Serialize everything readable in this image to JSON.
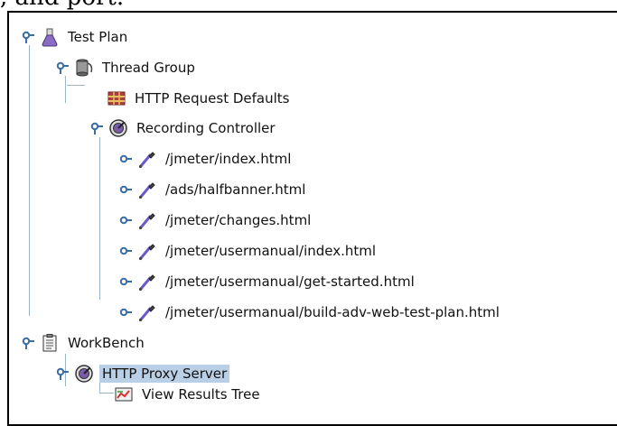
{
  "caption": ", and port.",
  "tree": {
    "test_plan": "Test Plan",
    "thread_group": "Thread Group",
    "http_request_defaults": "HTTP Request Defaults",
    "recording_controller": "Recording Controller",
    "samplers": [
      "/jmeter/index.html",
      "/ads/halfbanner.html",
      "/jmeter/changes.html",
      "/jmeter/usermanual/index.html",
      "/jmeter/usermanual/get-started.html",
      "/jmeter/usermanual/build-adv-web-test-plan.html"
    ],
    "workbench": "WorkBench",
    "http_proxy_server": "HTTP Proxy Server",
    "view_results_tree": "View Results Tree"
  },
  "colors": {
    "selection": "#b8cfe5",
    "tree_line": "#9bb3c7",
    "toggle": "#3a6ea5"
  }
}
